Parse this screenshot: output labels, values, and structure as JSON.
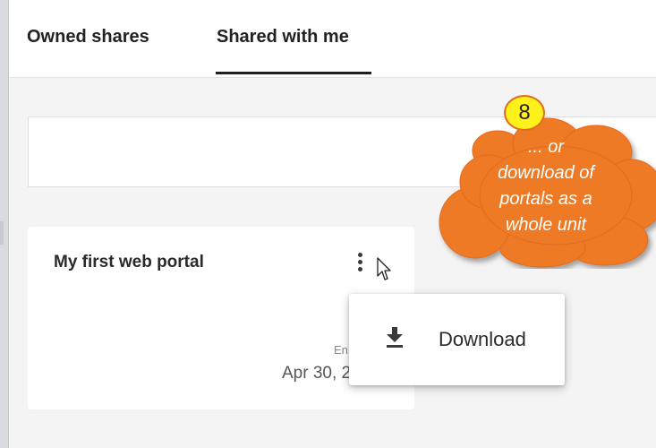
{
  "tabs": [
    {
      "label": "Owned shares"
    },
    {
      "label": "Shared with me"
    }
  ],
  "card": {
    "title": "My first web portal",
    "end_label_partial": "En",
    "date_partial": "Apr 30, 2"
  },
  "menu": {
    "download_label": "Download"
  },
  "callout": {
    "badge": "8",
    "line1": "... or",
    "line2": "download of",
    "line3": "portals as a",
    "line4": "whole unit"
  },
  "colors": {
    "callout_fill": "#ee7a26",
    "callout_border": "#e36a20",
    "badge_fill": "#fff21a",
    "active_tab_underline": "#1f1f1f"
  },
  "icons": [
    "kebab-menu-icon",
    "mouse-cursor-icon",
    "download-icon"
  ]
}
